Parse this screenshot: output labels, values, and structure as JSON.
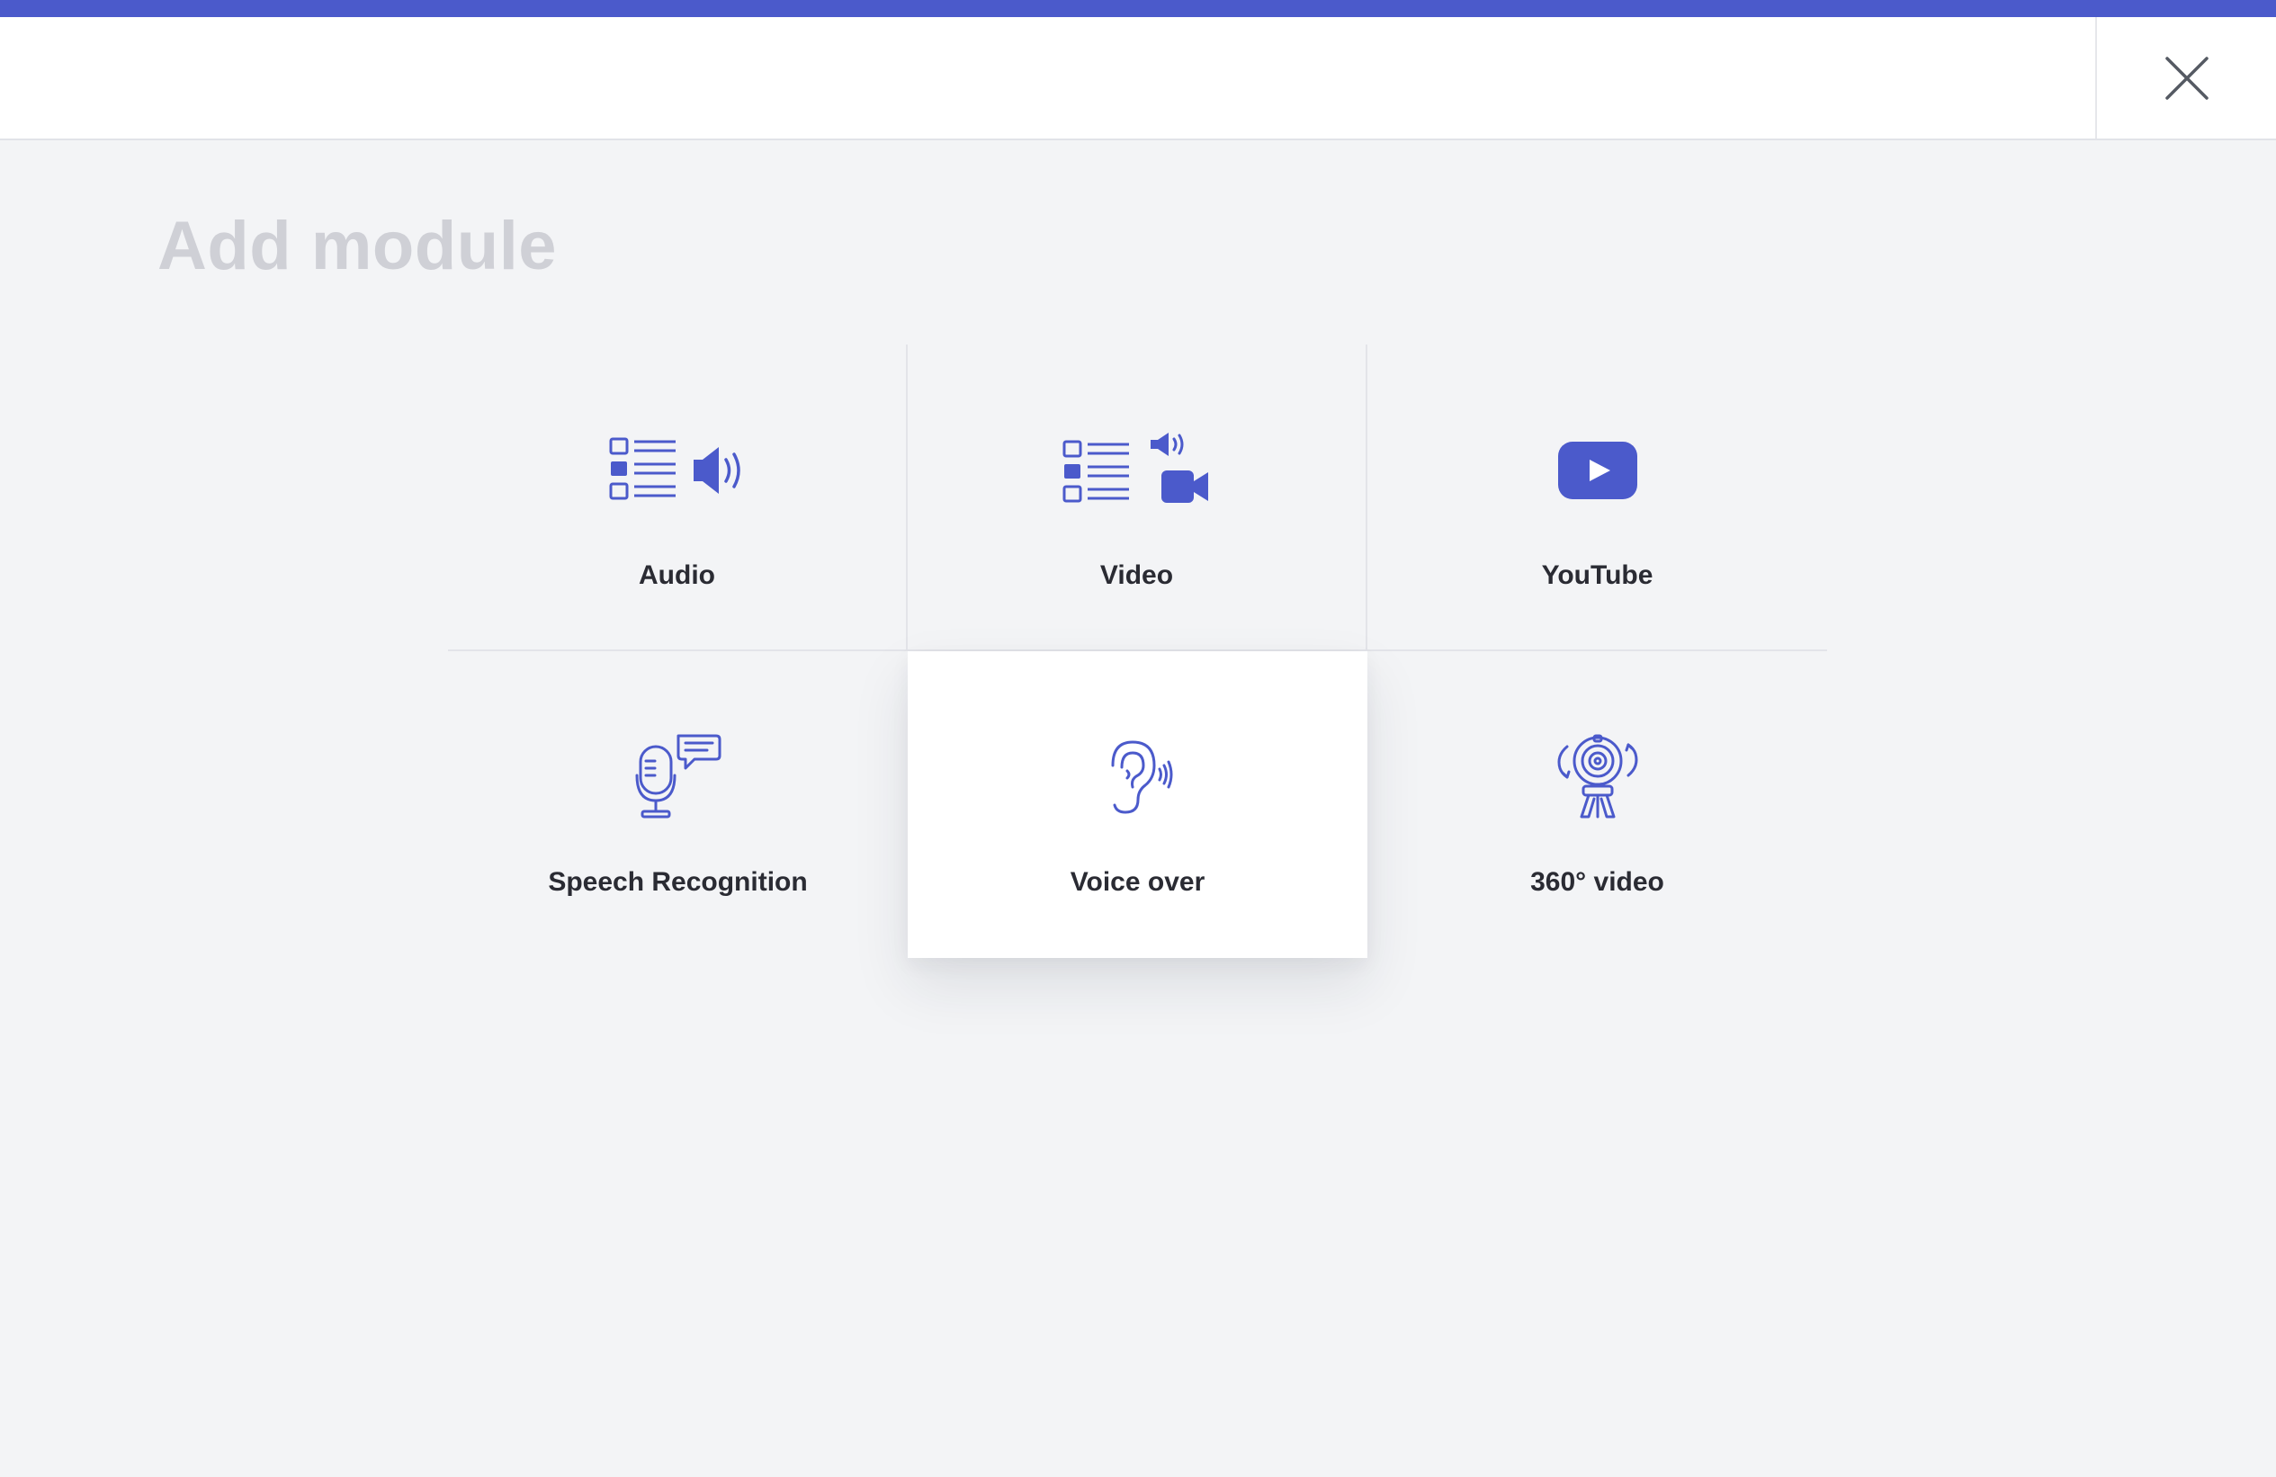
{
  "header": {
    "close_icon": "close-icon"
  },
  "page": {
    "title": "Add module"
  },
  "modules": [
    {
      "label": "Audio",
      "icon": "audio-list-icon"
    },
    {
      "label": "Video",
      "icon": "video-list-icon"
    },
    {
      "label": "YouTube",
      "icon": "youtube-icon"
    },
    {
      "label": "Speech Recognition",
      "icon": "microphone-speech-icon"
    },
    {
      "label": "Voice over",
      "icon": "ear-icon"
    },
    {
      "label": "360° video",
      "icon": "360-camera-icon"
    }
  ],
  "colors": {
    "accent": "#4b5acb",
    "title": "#cfd0d6",
    "label": "#2a2b33",
    "background": "#f3f4f6",
    "selected_tile": "#ffffff"
  }
}
